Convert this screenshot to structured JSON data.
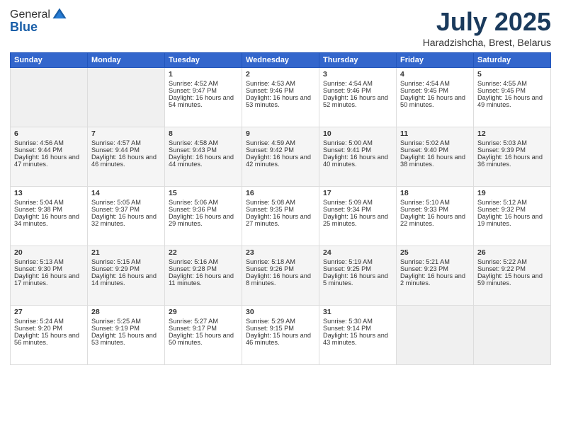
{
  "header": {
    "logo_line1": "General",
    "logo_line2": "Blue",
    "month": "July 2025",
    "location": "Haradzishcha, Brest, Belarus"
  },
  "days_of_week": [
    "Sunday",
    "Monday",
    "Tuesday",
    "Wednesday",
    "Thursday",
    "Friday",
    "Saturday"
  ],
  "weeks": [
    [
      {
        "day": "",
        "empty": true
      },
      {
        "day": "",
        "empty": true
      },
      {
        "day": "1",
        "sunrise": "Sunrise: 4:52 AM",
        "sunset": "Sunset: 9:47 PM",
        "daylight": "Daylight: 16 hours and 54 minutes."
      },
      {
        "day": "2",
        "sunrise": "Sunrise: 4:53 AM",
        "sunset": "Sunset: 9:46 PM",
        "daylight": "Daylight: 16 hours and 53 minutes."
      },
      {
        "day": "3",
        "sunrise": "Sunrise: 4:54 AM",
        "sunset": "Sunset: 9:46 PM",
        "daylight": "Daylight: 16 hours and 52 minutes."
      },
      {
        "day": "4",
        "sunrise": "Sunrise: 4:54 AM",
        "sunset": "Sunset: 9:45 PM",
        "daylight": "Daylight: 16 hours and 50 minutes."
      },
      {
        "day": "5",
        "sunrise": "Sunrise: 4:55 AM",
        "sunset": "Sunset: 9:45 PM",
        "daylight": "Daylight: 16 hours and 49 minutes."
      }
    ],
    [
      {
        "day": "6",
        "sunrise": "Sunrise: 4:56 AM",
        "sunset": "Sunset: 9:44 PM",
        "daylight": "Daylight: 16 hours and 47 minutes."
      },
      {
        "day": "7",
        "sunrise": "Sunrise: 4:57 AM",
        "sunset": "Sunset: 9:44 PM",
        "daylight": "Daylight: 16 hours and 46 minutes."
      },
      {
        "day": "8",
        "sunrise": "Sunrise: 4:58 AM",
        "sunset": "Sunset: 9:43 PM",
        "daylight": "Daylight: 16 hours and 44 minutes."
      },
      {
        "day": "9",
        "sunrise": "Sunrise: 4:59 AM",
        "sunset": "Sunset: 9:42 PM",
        "daylight": "Daylight: 16 hours and 42 minutes."
      },
      {
        "day": "10",
        "sunrise": "Sunrise: 5:00 AM",
        "sunset": "Sunset: 9:41 PM",
        "daylight": "Daylight: 16 hours and 40 minutes."
      },
      {
        "day": "11",
        "sunrise": "Sunrise: 5:02 AM",
        "sunset": "Sunset: 9:40 PM",
        "daylight": "Daylight: 16 hours and 38 minutes."
      },
      {
        "day": "12",
        "sunrise": "Sunrise: 5:03 AM",
        "sunset": "Sunset: 9:39 PM",
        "daylight": "Daylight: 16 hours and 36 minutes."
      }
    ],
    [
      {
        "day": "13",
        "sunrise": "Sunrise: 5:04 AM",
        "sunset": "Sunset: 9:38 PM",
        "daylight": "Daylight: 16 hours and 34 minutes."
      },
      {
        "day": "14",
        "sunrise": "Sunrise: 5:05 AM",
        "sunset": "Sunset: 9:37 PM",
        "daylight": "Daylight: 16 hours and 32 minutes."
      },
      {
        "day": "15",
        "sunrise": "Sunrise: 5:06 AM",
        "sunset": "Sunset: 9:36 PM",
        "daylight": "Daylight: 16 hours and 29 minutes."
      },
      {
        "day": "16",
        "sunrise": "Sunrise: 5:08 AM",
        "sunset": "Sunset: 9:35 PM",
        "daylight": "Daylight: 16 hours and 27 minutes."
      },
      {
        "day": "17",
        "sunrise": "Sunrise: 5:09 AM",
        "sunset": "Sunset: 9:34 PM",
        "daylight": "Daylight: 16 hours and 25 minutes."
      },
      {
        "day": "18",
        "sunrise": "Sunrise: 5:10 AM",
        "sunset": "Sunset: 9:33 PM",
        "daylight": "Daylight: 16 hours and 22 minutes."
      },
      {
        "day": "19",
        "sunrise": "Sunrise: 5:12 AM",
        "sunset": "Sunset: 9:32 PM",
        "daylight": "Daylight: 16 hours and 19 minutes."
      }
    ],
    [
      {
        "day": "20",
        "sunrise": "Sunrise: 5:13 AM",
        "sunset": "Sunset: 9:30 PM",
        "daylight": "Daylight: 16 hours and 17 minutes."
      },
      {
        "day": "21",
        "sunrise": "Sunrise: 5:15 AM",
        "sunset": "Sunset: 9:29 PM",
        "daylight": "Daylight: 16 hours and 14 minutes."
      },
      {
        "day": "22",
        "sunrise": "Sunrise: 5:16 AM",
        "sunset": "Sunset: 9:28 PM",
        "daylight": "Daylight: 16 hours and 11 minutes."
      },
      {
        "day": "23",
        "sunrise": "Sunrise: 5:18 AM",
        "sunset": "Sunset: 9:26 PM",
        "daylight": "Daylight: 16 hours and 8 minutes."
      },
      {
        "day": "24",
        "sunrise": "Sunrise: 5:19 AM",
        "sunset": "Sunset: 9:25 PM",
        "daylight": "Daylight: 16 hours and 5 minutes."
      },
      {
        "day": "25",
        "sunrise": "Sunrise: 5:21 AM",
        "sunset": "Sunset: 9:23 PM",
        "daylight": "Daylight: 16 hours and 2 minutes."
      },
      {
        "day": "26",
        "sunrise": "Sunrise: 5:22 AM",
        "sunset": "Sunset: 9:22 PM",
        "daylight": "Daylight: 15 hours and 59 minutes."
      }
    ],
    [
      {
        "day": "27",
        "sunrise": "Sunrise: 5:24 AM",
        "sunset": "Sunset: 9:20 PM",
        "daylight": "Daylight: 15 hours and 56 minutes."
      },
      {
        "day": "28",
        "sunrise": "Sunrise: 5:25 AM",
        "sunset": "Sunset: 9:19 PM",
        "daylight": "Daylight: 15 hours and 53 minutes."
      },
      {
        "day": "29",
        "sunrise": "Sunrise: 5:27 AM",
        "sunset": "Sunset: 9:17 PM",
        "daylight": "Daylight: 15 hours and 50 minutes."
      },
      {
        "day": "30",
        "sunrise": "Sunrise: 5:29 AM",
        "sunset": "Sunset: 9:15 PM",
        "daylight": "Daylight: 15 hours and 46 minutes."
      },
      {
        "day": "31",
        "sunrise": "Sunrise: 5:30 AM",
        "sunset": "Sunset: 9:14 PM",
        "daylight": "Daylight: 15 hours and 43 minutes."
      },
      {
        "day": "",
        "empty": true
      },
      {
        "day": "",
        "empty": true
      }
    ]
  ]
}
